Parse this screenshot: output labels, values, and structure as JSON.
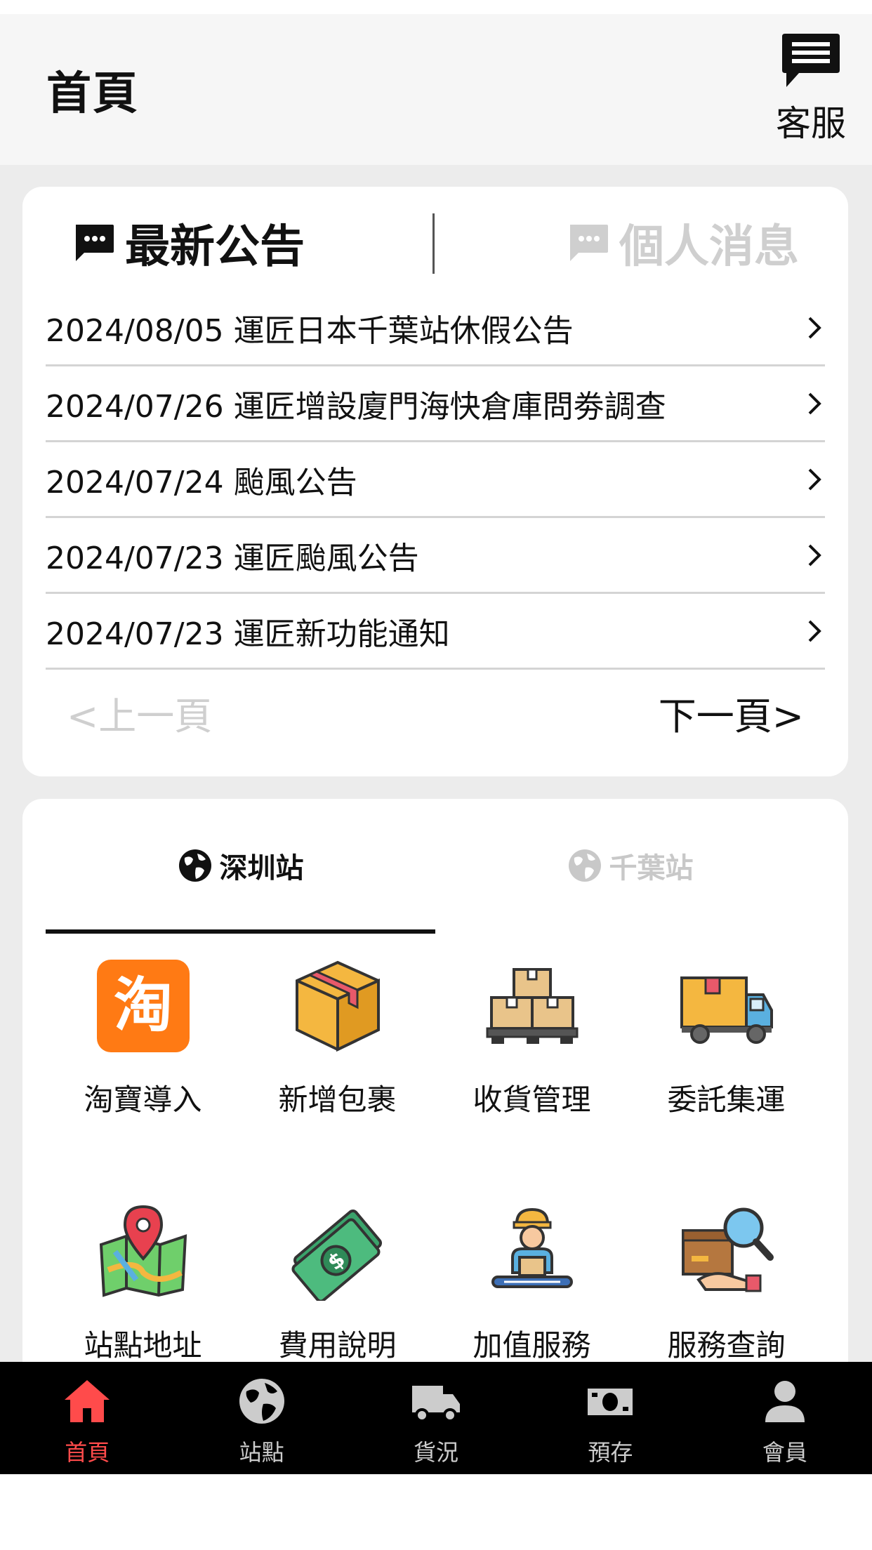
{
  "header": {
    "title": "首頁",
    "customer_service_label": "客服"
  },
  "notice": {
    "tabs": [
      {
        "label": "最新公告",
        "icon": "chat-icon",
        "active": true
      },
      {
        "label": "個人消息",
        "icon": "chat-icon",
        "active": false
      }
    ],
    "items": [
      {
        "text": "2024/08/05 運匠日本千葉站休假公告"
      },
      {
        "text": "2024/07/26 運匠增設廈門海快倉庫問劵調查"
      },
      {
        "text": "2024/07/24 颱風公告"
      },
      {
        "text": "2024/07/23 運匠颱風公告"
      },
      {
        "text": "2024/07/23 運匠新功能通知"
      }
    ],
    "prev_label": "<上一頁",
    "next_label": "下一頁>"
  },
  "stations": {
    "tabs": [
      {
        "label": "深圳站",
        "icon": "globe-icon",
        "active": true
      },
      {
        "label": "千葉站",
        "icon": "globe-icon",
        "active": false
      }
    ],
    "services": [
      {
        "label": "淘寶導入",
        "icon": "taobao-icon"
      },
      {
        "label": "新增包裹",
        "icon": "package-box-icon"
      },
      {
        "label": "收貨管理",
        "icon": "boxes-pallet-icon"
      },
      {
        "label": "委託集運",
        "icon": "delivery-truck-icon"
      },
      {
        "label": "站點地址",
        "icon": "map-pin-icon"
      },
      {
        "label": "費用說明",
        "icon": "money-bill-icon"
      },
      {
        "label": "加值服務",
        "icon": "worker-icon"
      },
      {
        "label": "服務查詢",
        "icon": "search-box-icon"
      }
    ]
  },
  "tabbar": {
    "items": [
      {
        "label": "首頁",
        "icon": "home-icon",
        "active": true
      },
      {
        "label": "站點",
        "icon": "globe-icon",
        "active": false
      },
      {
        "label": "貨況",
        "icon": "truck-icon",
        "active": false
      },
      {
        "label": "預存",
        "icon": "money-icon",
        "active": false
      },
      {
        "label": "會員",
        "icon": "user-icon",
        "active": false
      }
    ]
  },
  "colors": {
    "accent": "#ff4b4b",
    "taobao": "#ff7a14",
    "tabbar_bg": "#000000",
    "inactive_text": "#cfcfcf"
  }
}
